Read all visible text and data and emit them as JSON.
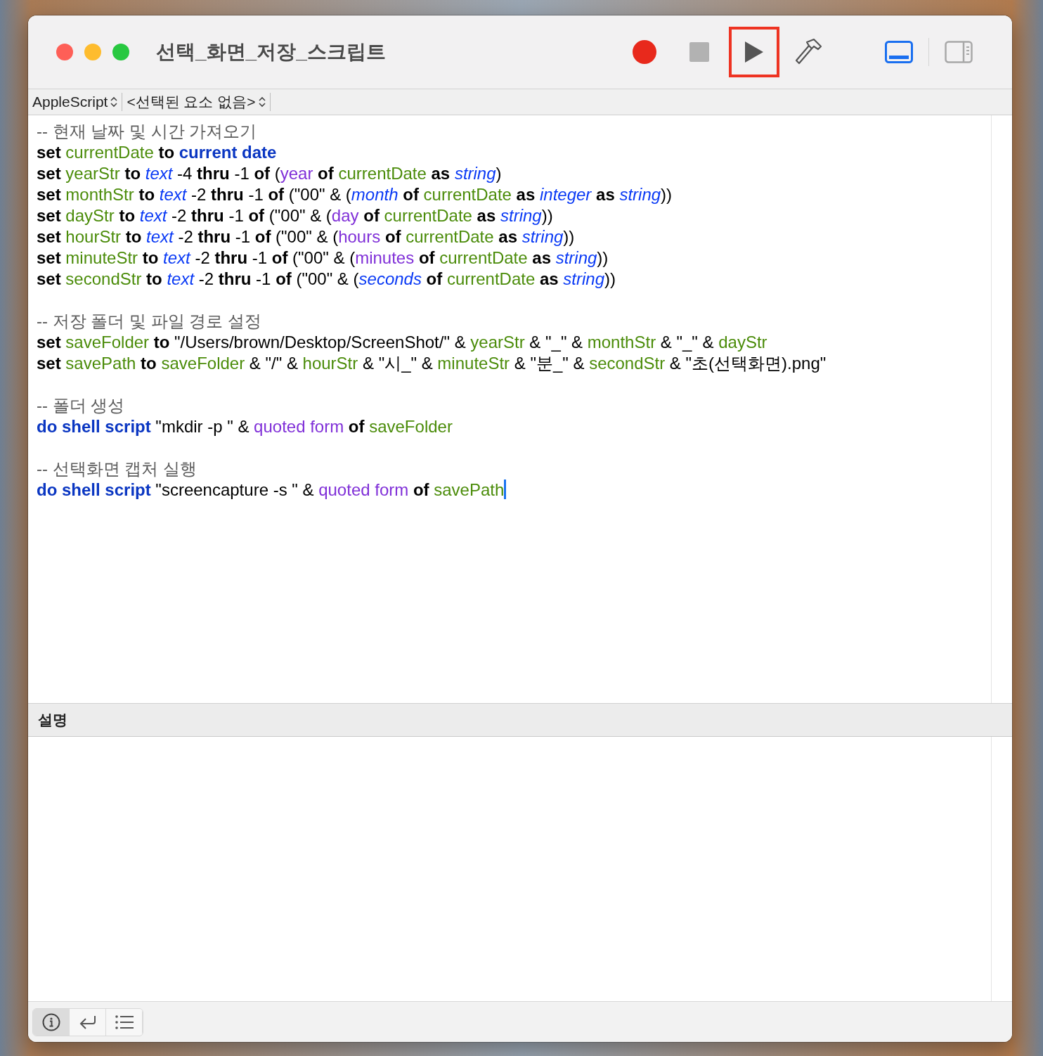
{
  "window": {
    "title": "선택_화면_저장_스크립트"
  },
  "toolbar": {
    "buttons": [
      {
        "kind": "record",
        "disabled": false,
        "highlighted": false
      },
      {
        "kind": "stop",
        "disabled": true,
        "highlighted": false
      },
      {
        "kind": "run",
        "disabled": false,
        "highlighted": true
      },
      {
        "kind": "compile",
        "disabled": false,
        "highlighted": false
      }
    ],
    "view_toggles": [
      {
        "kind": "bottom_panel",
        "selected": true
      },
      {
        "kind": "sidebar",
        "selected": false
      }
    ]
  },
  "navigation_bar": {
    "language": "AppleScript",
    "element": "<선택된 요소 없음>"
  },
  "editor": {
    "blocks": [
      {
        "lines": [
          {
            "tokens": [
              {
                "kind": "comment",
                "text": "-- 현재 날짜 및 시간 가져오기"
              }
            ]
          },
          {
            "tokens": [
              {
                "kind": "kw",
                "text": "set "
              },
              {
                "kind": "var",
                "text": "currentDate"
              },
              {
                "kind": "kw",
                "text": " to "
              },
              {
                "kind": "cmd",
                "text": "current date"
              }
            ]
          },
          {
            "tokens": [
              {
                "kind": "kw",
                "text": "set "
              },
              {
                "kind": "var",
                "text": "yearStr"
              },
              {
                "kind": "kw",
                "text": " to "
              },
              {
                "kind": "cls",
                "text": "text"
              },
              {
                "kind": "plain",
                "text": " -4 "
              },
              {
                "kind": "kw",
                "text": "thru"
              },
              {
                "kind": "plain",
                "text": " -1 "
              },
              {
                "kind": "kw",
                "text": "of"
              },
              {
                "kind": "plain",
                "text": " ("
              },
              {
                "kind": "prop",
                "text": "year"
              },
              {
                "kind": "kw",
                "text": " of "
              },
              {
                "kind": "var",
                "text": "currentDate"
              },
              {
                "kind": "kw",
                "text": " as "
              },
              {
                "kind": "cls",
                "text": "string"
              },
              {
                "kind": "plain",
                "text": ")"
              }
            ]
          },
          {
            "tokens": [
              {
                "kind": "kw",
                "text": "set "
              },
              {
                "kind": "var",
                "text": "monthStr"
              },
              {
                "kind": "kw",
                "text": " to "
              },
              {
                "kind": "cls",
                "text": "text"
              },
              {
                "kind": "plain",
                "text": " -2 "
              },
              {
                "kind": "kw",
                "text": "thru"
              },
              {
                "kind": "plain",
                "text": " -1 "
              },
              {
                "kind": "kw",
                "text": "of"
              },
              {
                "kind": "plain",
                "text": " (\"00\" & ("
              },
              {
                "kind": "cls",
                "text": "month"
              },
              {
                "kind": "kw",
                "text": " of "
              },
              {
                "kind": "var",
                "text": "currentDate"
              },
              {
                "kind": "kw",
                "text": " as "
              },
              {
                "kind": "cls",
                "text": "integer"
              },
              {
                "kind": "kw",
                "text": " as "
              },
              {
                "kind": "cls",
                "text": "string"
              },
              {
                "kind": "plain",
                "text": "))"
              }
            ]
          },
          {
            "tokens": [
              {
                "kind": "kw",
                "text": "set "
              },
              {
                "kind": "var",
                "text": "dayStr"
              },
              {
                "kind": "kw",
                "text": " to "
              },
              {
                "kind": "cls",
                "text": "text"
              },
              {
                "kind": "plain",
                "text": " -2 "
              },
              {
                "kind": "kw",
                "text": "thru"
              },
              {
                "kind": "plain",
                "text": " -1 "
              },
              {
                "kind": "kw",
                "text": "of"
              },
              {
                "kind": "plain",
                "text": " (\"00\" & ("
              },
              {
                "kind": "prop",
                "text": "day"
              },
              {
                "kind": "kw",
                "text": " of "
              },
              {
                "kind": "var",
                "text": "currentDate"
              },
              {
                "kind": "kw",
                "text": " as "
              },
              {
                "kind": "cls",
                "text": "string"
              },
              {
                "kind": "plain",
                "text": "))"
              }
            ]
          },
          {
            "tokens": [
              {
                "kind": "kw",
                "text": "set "
              },
              {
                "kind": "var",
                "text": "hourStr"
              },
              {
                "kind": "kw",
                "text": " to "
              },
              {
                "kind": "cls",
                "text": "text"
              },
              {
                "kind": "plain",
                "text": " -2 "
              },
              {
                "kind": "kw",
                "text": "thru"
              },
              {
                "kind": "plain",
                "text": " -1 "
              },
              {
                "kind": "kw",
                "text": "of"
              },
              {
                "kind": "plain",
                "text": " (\"00\" & ("
              },
              {
                "kind": "prop",
                "text": "hours"
              },
              {
                "kind": "kw",
                "text": " of "
              },
              {
                "kind": "var",
                "text": "currentDate"
              },
              {
                "kind": "kw",
                "text": " as "
              },
              {
                "kind": "cls",
                "text": "string"
              },
              {
                "kind": "plain",
                "text": "))"
              }
            ]
          },
          {
            "tokens": [
              {
                "kind": "kw",
                "text": "set "
              },
              {
                "kind": "var",
                "text": "minuteStr"
              },
              {
                "kind": "kw",
                "text": " to "
              },
              {
                "kind": "cls",
                "text": "text"
              },
              {
                "kind": "plain",
                "text": " -2 "
              },
              {
                "kind": "kw",
                "text": "thru"
              },
              {
                "kind": "plain",
                "text": " -1 "
              },
              {
                "kind": "kw",
                "text": "of"
              },
              {
                "kind": "plain",
                "text": " (\"00\" & ("
              },
              {
                "kind": "prop",
                "text": "minutes"
              },
              {
                "kind": "kw",
                "text": " of "
              },
              {
                "kind": "var",
                "text": "currentDate"
              },
              {
                "kind": "kw",
                "text": " as "
              },
              {
                "kind": "cls",
                "text": "string"
              },
              {
                "kind": "plain",
                "text": "))"
              }
            ]
          },
          {
            "tokens": [
              {
                "kind": "kw",
                "text": "set "
              },
              {
                "kind": "var",
                "text": "secondStr"
              },
              {
                "kind": "kw",
                "text": " to "
              },
              {
                "kind": "cls",
                "text": "text"
              },
              {
                "kind": "plain",
                "text": " -2 "
              },
              {
                "kind": "kw",
                "text": "thru"
              },
              {
                "kind": "plain",
                "text": " -1 "
              },
              {
                "kind": "kw",
                "text": "of"
              },
              {
                "kind": "plain",
                "text": " (\"00\" & ("
              },
              {
                "kind": "cls",
                "text": "seconds"
              },
              {
                "kind": "kw",
                "text": " of "
              },
              {
                "kind": "var",
                "text": "currentDate"
              },
              {
                "kind": "kw",
                "text": " as "
              },
              {
                "kind": "cls",
                "text": "string"
              },
              {
                "kind": "plain",
                "text": "))"
              }
            ]
          }
        ]
      },
      {
        "lines": [
          {
            "tokens": [
              {
                "kind": "comment",
                "text": "-- 저장 폴더 및 파일 경로 설정"
              }
            ]
          },
          {
            "tokens": [
              {
                "kind": "kw",
                "text": "set "
              },
              {
                "kind": "var",
                "text": "saveFolder"
              },
              {
                "kind": "kw",
                "text": " to "
              },
              {
                "kind": "plain",
                "text": "\"/Users/brown/Desktop/ScreenShot/\" & "
              },
              {
                "kind": "var",
                "text": "yearStr"
              },
              {
                "kind": "plain",
                "text": " & \"_\" & "
              },
              {
                "kind": "var",
                "text": "monthStr"
              },
              {
                "kind": "plain",
                "text": " & \"_\" & "
              },
              {
                "kind": "var",
                "text": "dayStr"
              }
            ]
          },
          {
            "tokens": [
              {
                "kind": "kw",
                "text": "set "
              },
              {
                "kind": "var",
                "text": "savePath"
              },
              {
                "kind": "kw",
                "text": " to "
              },
              {
                "kind": "var",
                "text": "saveFolder"
              },
              {
                "kind": "plain",
                "text": " & \"/\" & "
              },
              {
                "kind": "var",
                "text": "hourStr"
              },
              {
                "kind": "plain",
                "text": " & \"시_\" & "
              },
              {
                "kind": "var",
                "text": "minuteStr"
              },
              {
                "kind": "plain",
                "text": " & \"분_\" & "
              },
              {
                "kind": "var",
                "text": "secondStr"
              },
              {
                "kind": "plain",
                "text": " & \"초(선택화면).png\""
              }
            ]
          }
        ]
      },
      {
        "lines": [
          {
            "tokens": [
              {
                "kind": "comment",
                "text": "-- 폴더 생성"
              }
            ]
          },
          {
            "tokens": [
              {
                "kind": "cmd",
                "text": "do shell script"
              },
              {
                "kind": "plain",
                "text": " \"mkdir -p \" & "
              },
              {
                "kind": "prop",
                "text": "quoted form"
              },
              {
                "kind": "kw",
                "text": " of "
              },
              {
                "kind": "var",
                "text": "saveFolder"
              }
            ]
          }
        ]
      },
      {
        "lines": [
          {
            "tokens": [
              {
                "kind": "comment",
                "text": "-- 선택화면 캡처 실행"
              }
            ]
          },
          {
            "tokens": [
              {
                "kind": "cmd",
                "text": "do shell script"
              },
              {
                "kind": "plain",
                "text": " \"screencapture -s \" & "
              },
              {
                "kind": "prop",
                "text": "quoted form"
              },
              {
                "kind": "kw",
                "text": " of "
              },
              {
                "kind": "var",
                "text": "savePath"
              }
            ],
            "cursor": true
          }
        ]
      }
    ]
  },
  "description": {
    "title": "설명"
  },
  "bottom_bar": [
    {
      "kind": "info",
      "selected": true
    },
    {
      "kind": "result",
      "selected": false
    },
    {
      "kind": "log",
      "selected": false
    }
  ]
}
